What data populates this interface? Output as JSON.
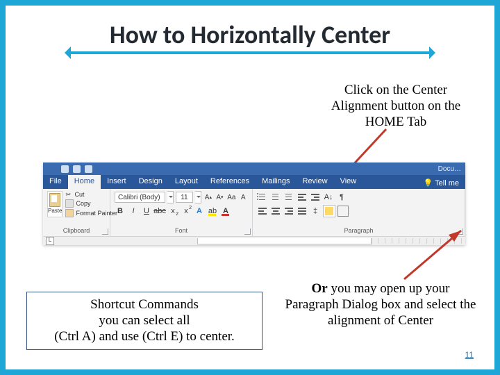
{
  "title": "How to Horizontally Center",
  "instruction_top": "Click on the Center Alignment button on the HOME Tab",
  "or_block": {
    "or": "Or",
    "rest": " you may open up your Paragraph Dialog box and select the alignment of Center"
  },
  "shortcut_box": "Shortcut Commands\nyou can select all\n(Ctrl A) and use (Ctrl E) to center.",
  "page_number": "11",
  "ribbon": {
    "doc_label": "Docu…",
    "tabs": {
      "file": "File",
      "home": "Home",
      "insert": "Insert",
      "design": "Design",
      "layout": "Layout",
      "references": "References",
      "mailings": "Mailings",
      "review": "Review",
      "view": "View",
      "tell_me": "Tell me"
    },
    "clipboard": {
      "paste": "Paste",
      "cut": "Cut",
      "copy": "Copy",
      "format_painter": "Format Painter",
      "label": "Clipboard"
    },
    "font": {
      "name": "Calibri (Body)",
      "size": "11",
      "label": "Font"
    },
    "paragraph": {
      "label": "Paragraph"
    }
  }
}
